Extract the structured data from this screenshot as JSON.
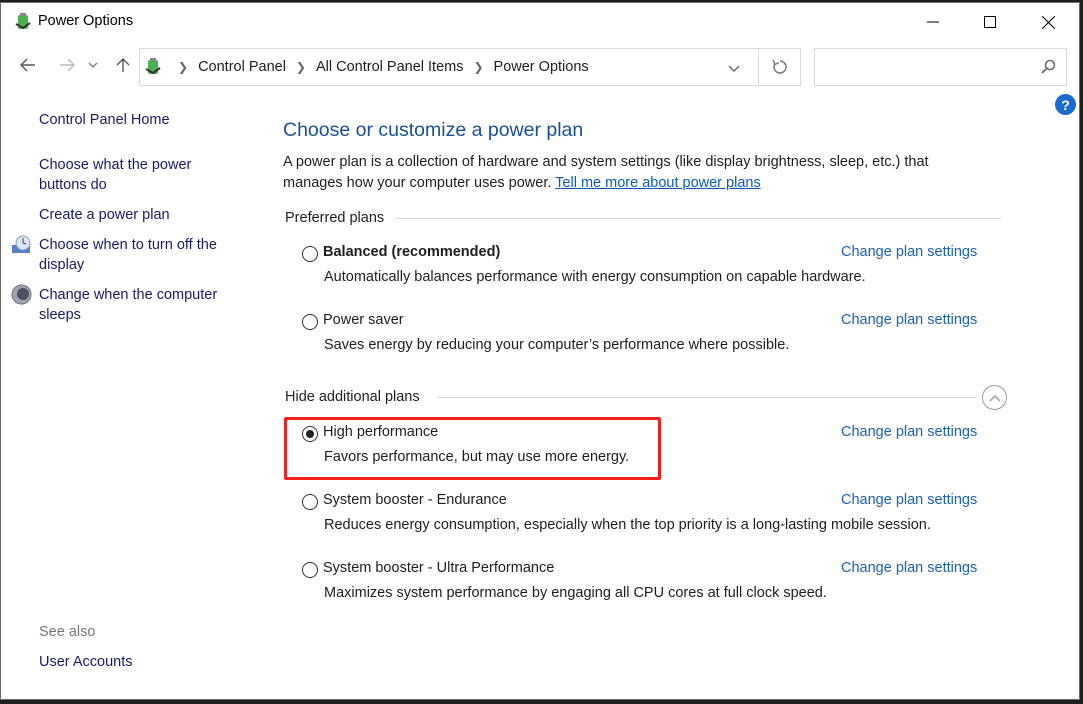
{
  "window": {
    "title": "Power Options",
    "controls": {
      "minimize": "minimize",
      "maximize": "maximize",
      "close": "close"
    }
  },
  "navigation": {
    "back": "back",
    "forward": "forward",
    "recent": "recent-locations",
    "up": "up",
    "breadcrumbs": [
      "Control Panel",
      "All Control Panel Items",
      "Power Options"
    ],
    "search_placeholder": "",
    "search_value": ""
  },
  "sidebar": {
    "items": [
      {
        "label": "Control Panel Home",
        "icon": null
      },
      {
        "label": "Choose what the power buttons do",
        "icon": null
      },
      {
        "label": "Create a power plan",
        "icon": null
      },
      {
        "label": "Choose when to turn off the display",
        "icon": "display-clock-icon"
      },
      {
        "label": "Change when the computer sleeps",
        "icon": "moon-sleep-icon"
      }
    ],
    "see_also_label": "See also",
    "see_also_items": [
      "User Accounts"
    ]
  },
  "main": {
    "heading": "Choose or customize a power plan",
    "intro_text": "A power plan is a collection of hardware and system settings (like display brightness, sleep, etc.) that manages how your computer uses power. ",
    "intro_link": "Tell me more about power plans",
    "preferred_label": "Preferred plans",
    "additional_label": "Hide additional plans",
    "change_link_label": "Change plan settings",
    "plans": [
      {
        "name": "Balanced (recommended)",
        "description": "Automatically balances performance with energy consumption on capable hardware.",
        "selected": false,
        "bold": true
      },
      {
        "name": "Power saver",
        "description": "Saves energy by reducing your computer’s performance where possible.",
        "selected": false
      },
      {
        "name": "High performance",
        "description": "Favors performance, but may use more energy.",
        "selected": true,
        "highlighted": true
      },
      {
        "name": "System booster - Endurance",
        "description": "Reduces energy consumption, especially when the top priority is a long-lasting mobile session.",
        "selected": false
      },
      {
        "name": "System booster - Ultra Performance",
        "description": "Maximizes system performance by engaging all CPU cores at full clock speed.",
        "selected": false
      }
    ]
  },
  "colors": {
    "heading": "#1a4f9c",
    "link": "#1a62b8",
    "sidebar_link": "#1a1a6a",
    "highlight_box": "#f02020",
    "help_badge": "#1a6ad0"
  }
}
